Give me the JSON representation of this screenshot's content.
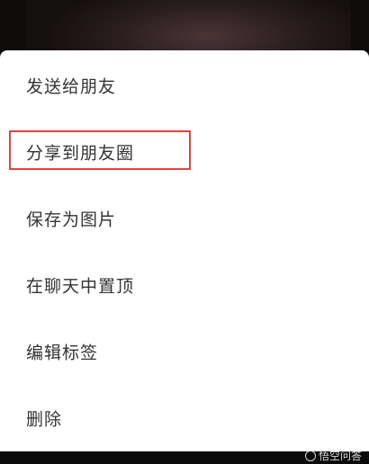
{
  "menu": {
    "items": [
      {
        "label": "发送给朋友"
      },
      {
        "label": "分享到朋友圈"
      },
      {
        "label": "保存为图片"
      },
      {
        "label": "在聊天中置顶"
      },
      {
        "label": "编辑标签"
      },
      {
        "label": "删除"
      }
    ]
  },
  "highlight": {
    "color": "#e0443e"
  },
  "watermark": {
    "text": "悟空问答"
  }
}
